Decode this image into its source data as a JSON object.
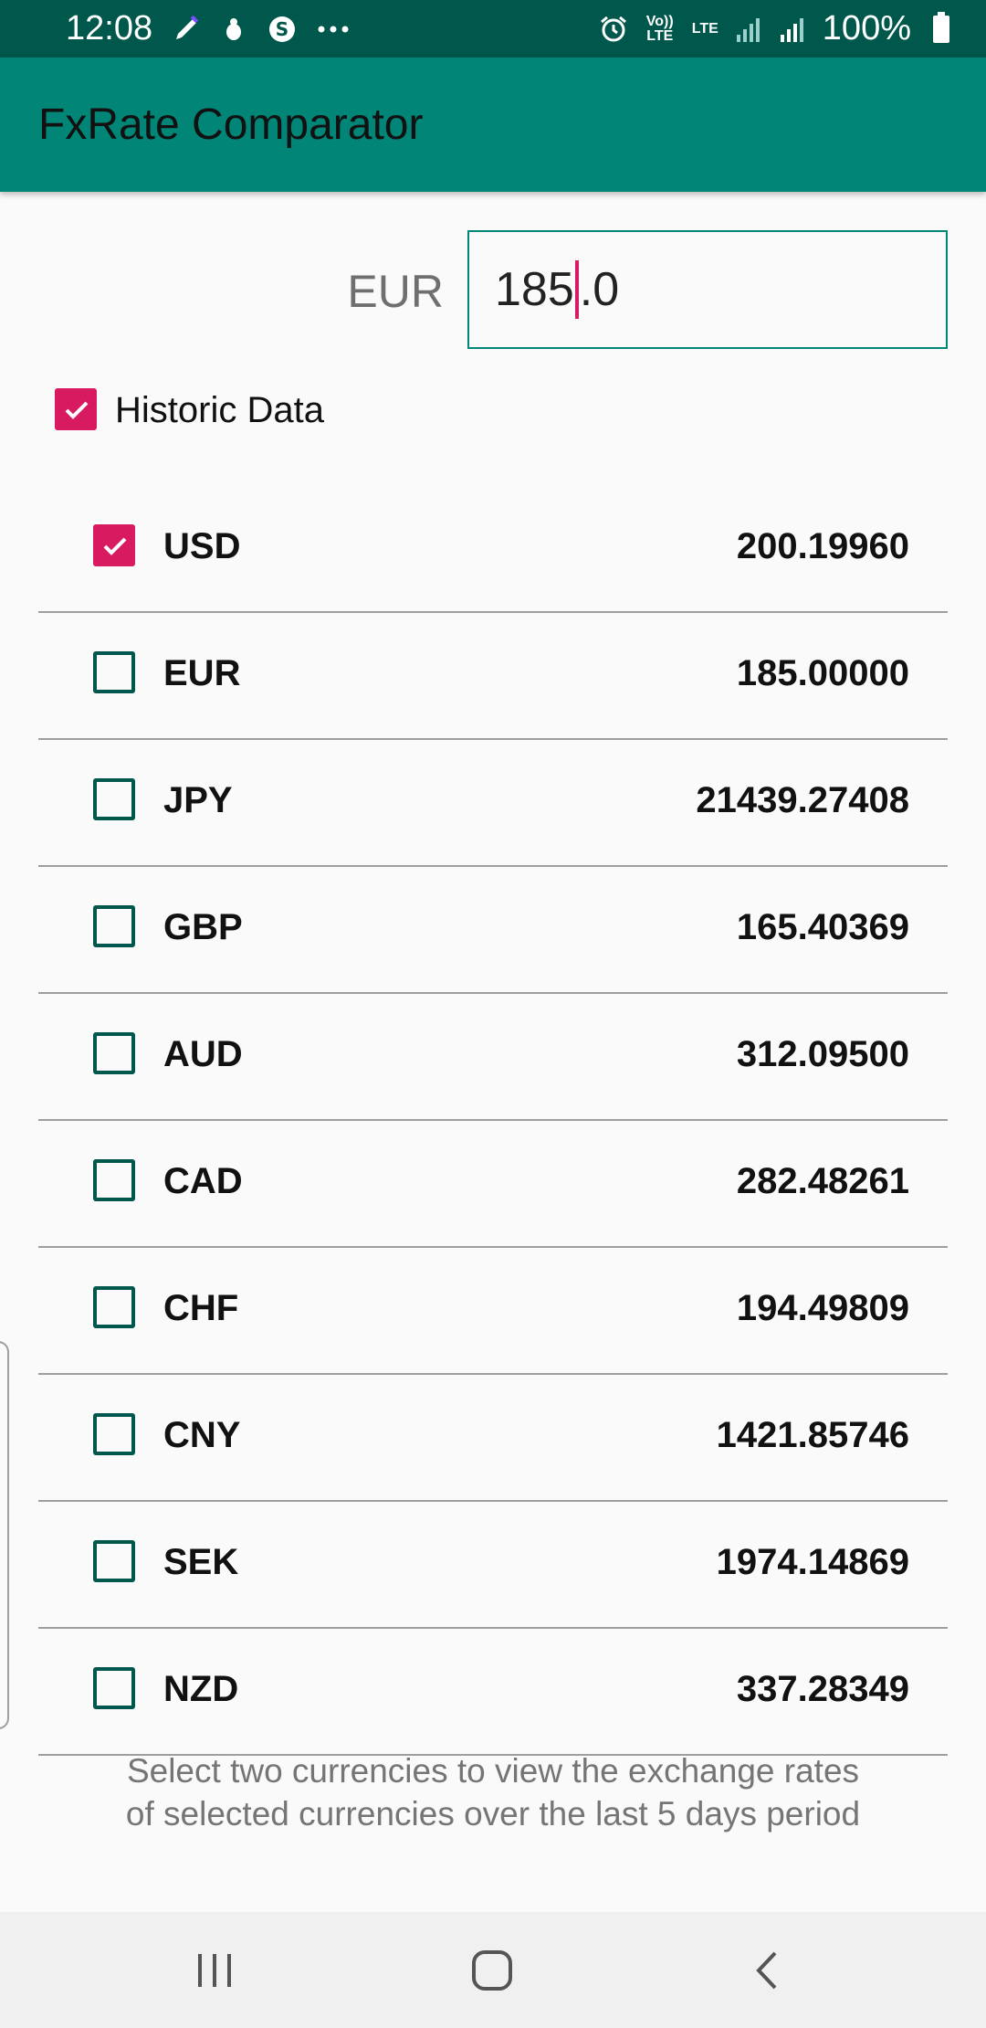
{
  "status_bar": {
    "time": "12:08",
    "notification_icons": [
      "pen-icon",
      "bug-icon",
      "skype-icon",
      "more-icon"
    ],
    "volte_label": "Vo)) LTE",
    "lte_label": "LTE",
    "battery_percent": "100%"
  },
  "app_bar": {
    "title": "FxRate Comparator"
  },
  "amount": {
    "currency": "EUR",
    "value_before_cursor": "185",
    "value_after_cursor": ".0"
  },
  "historic": {
    "label": "Historic Data",
    "checked": true
  },
  "currencies": [
    {
      "code": "USD",
      "value": "200.19960",
      "checked": true
    },
    {
      "code": "EUR",
      "value": "185.00000",
      "checked": false
    },
    {
      "code": "JPY",
      "value": "21439.27408",
      "checked": false
    },
    {
      "code": "GBP",
      "value": "165.40369",
      "checked": false
    },
    {
      "code": "AUD",
      "value": "312.09500",
      "checked": false
    },
    {
      "code": "CAD",
      "value": "282.48261",
      "checked": false
    },
    {
      "code": "CHF",
      "value": "194.49809",
      "checked": false
    },
    {
      "code": "CNY",
      "value": "1421.85746",
      "checked": false
    },
    {
      "code": "SEK",
      "value": "1974.14869",
      "checked": false
    },
    {
      "code": "NZD",
      "value": "337.28349",
      "checked": false
    }
  ],
  "hint": "Select two currencies to view the exchange rates of selected currencies over the last 5 days period",
  "colors": {
    "primary": "#008577",
    "primary_dark": "#00574b",
    "accent": "#d81b60"
  }
}
